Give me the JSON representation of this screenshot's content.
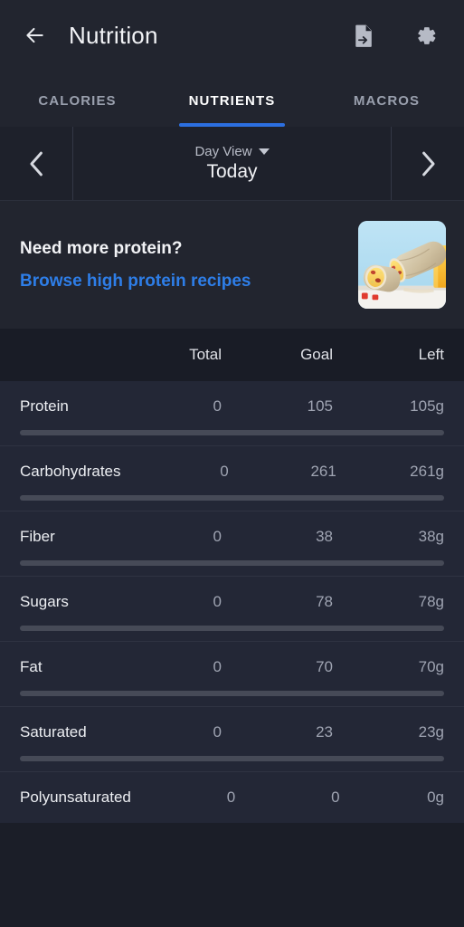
{
  "app": {
    "title": "Nutrition",
    "back_icon": "arrow-left-icon",
    "export_icon": "document-export-icon",
    "settings_icon": "gear-icon",
    "accent_color": "#2c6fe0",
    "link_color": "#2e7ee8",
    "background_color": "#1b1e28"
  },
  "tabs": [
    {
      "label": "CALORIES",
      "active": false
    },
    {
      "label": "NUTRIENTS",
      "active": true
    },
    {
      "label": "MACROS",
      "active": false
    }
  ],
  "date_nav": {
    "prev_icon": "chevron-left-icon",
    "next_icon": "chevron-right-icon",
    "view_mode": "Day View",
    "dropdown_icon": "caret-down-icon",
    "current_date": "Today"
  },
  "promo": {
    "title": "Need more protein?",
    "link": "Browse high protein recipes",
    "thumbnail": "breakfast-burrito-photo"
  },
  "table": {
    "headers": {
      "name": "",
      "total": "Total",
      "goal": "Goal",
      "left": "Left"
    },
    "rows": [
      {
        "name": "Protein",
        "total": "0",
        "goal": "105",
        "left": "105g",
        "progress_pct": 0,
        "clipped": false
      },
      {
        "name": "Carbohydrates",
        "total": "0",
        "goal": "261",
        "left": "261g",
        "progress_pct": 0,
        "clipped": false
      },
      {
        "name": "Fiber",
        "total": "0",
        "goal": "38",
        "left": "38g",
        "progress_pct": 0,
        "clipped": false
      },
      {
        "name": "Sugars",
        "total": "0",
        "goal": "78",
        "left": "78g",
        "progress_pct": 0,
        "clipped": false
      },
      {
        "name": "Fat",
        "total": "0",
        "goal": "70",
        "left": "70g",
        "progress_pct": 0,
        "clipped": false
      },
      {
        "name": "Saturated",
        "total": "0",
        "goal": "23",
        "left": "23g",
        "progress_pct": 0,
        "clipped": false
      },
      {
        "name": "Polyunsaturated",
        "total": "0",
        "goal": "0",
        "left": "0g",
        "progress_pct": 0,
        "clipped": true
      }
    ]
  }
}
